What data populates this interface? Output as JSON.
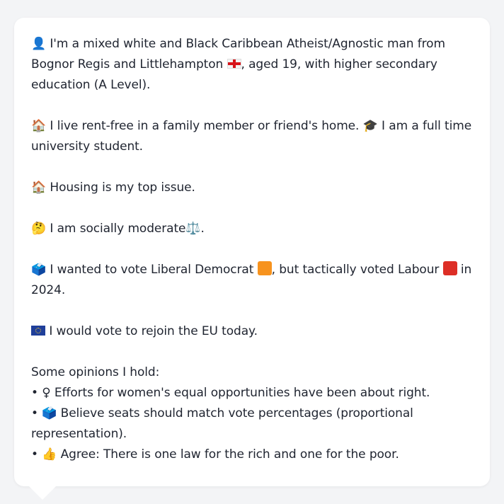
{
  "colors": {
    "background": "#f3f4f6",
    "card": "#ffffff",
    "text": "#1f2430",
    "libdem": "#faa61a",
    "labour": "#e4003b"
  },
  "profile": {
    "p1_icon": "👤",
    "p1_text": "I'm a mixed white and Black Caribbean Atheist/Agnostic man from Bognor Regis and Littlehampton",
    "p1_flag_icon": "england-flag-icon",
    "p1_text2": ", aged 19, with higher secondary education (A Level).",
    "p2_icon": "🏠",
    "p2_text": "I live rent-free in a family member or friend's home.",
    "p2_icon2": "🎓",
    "p2_text2": "I am a full time university student.",
    "p3_icon": "🏠",
    "p3_text": "Housing is my top issue.",
    "p4_icon": "🤔",
    "p4_text": "I am socially moderate",
    "p4_icon2": "⚖️",
    "p4_text2": ".",
    "p5_icon": "🗳️",
    "p5_text": "I wanted to vote Liberal Democrat",
    "p5_text2": ", but tactically voted Labour",
    "p5_text3": " in 2024.",
    "p6_flag_icon": "eu-flag-icon",
    "p6_text": "I would vote to rejoin the EU today.",
    "opinions_heading": "Some opinions I hold:",
    "opinions": [
      {
        "bullet": "•",
        "icon": "♀",
        "text": "Efforts for women's equal opportunities have been about right."
      },
      {
        "bullet": "•",
        "icon": "🗳️",
        "text": "Believe seats should match vote percentages (proportional representation)."
      },
      {
        "bullet": "•",
        "icon": "👍",
        "text": "Agree: There is one law for the rich and one for the poor."
      }
    ]
  }
}
